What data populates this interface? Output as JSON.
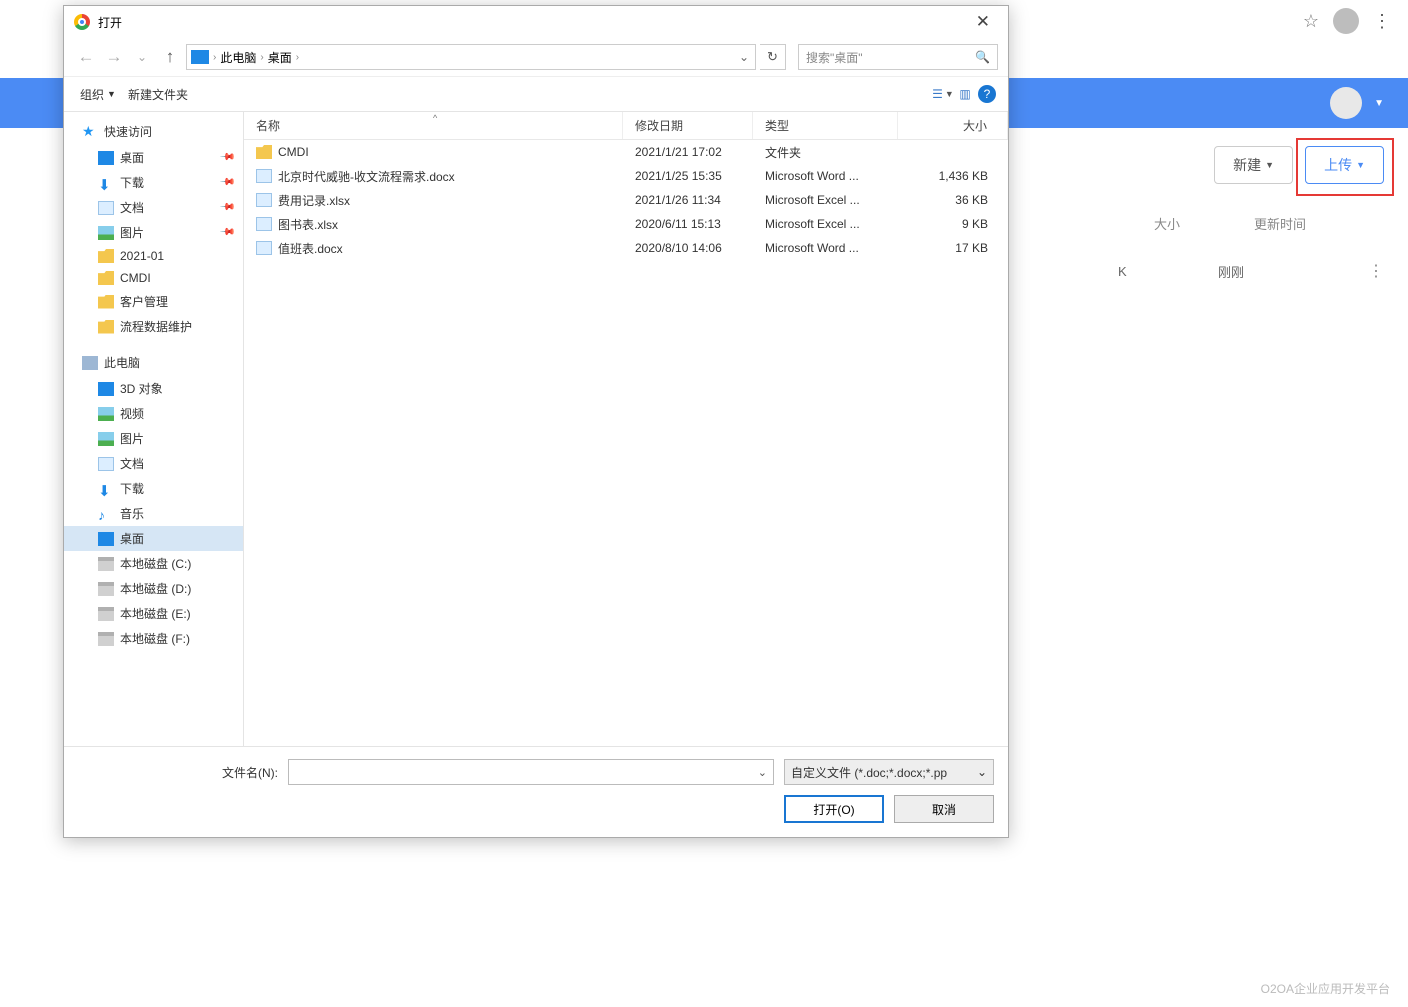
{
  "browser": {
    "star": "☆",
    "kebab": "⋮"
  },
  "web": {
    "new_label": "新建",
    "upload_label": "上传",
    "col_size": "大小",
    "col_time": "更新时间",
    "row_size": "K",
    "row_time": "刚刚",
    "row_more": "⋮"
  },
  "watermark": "O2OA企业应用开发平台",
  "dialog": {
    "title": "打开",
    "close_x": "✕",
    "path": {
      "seg1": "此电脑",
      "seg2": "桌面"
    },
    "refresh": "↻",
    "search_placeholder": "搜索\"桌面\"",
    "search_icon": "🔍",
    "toolbar": {
      "organize": "组织",
      "new_folder": "新建文件夹",
      "view_glyph": "☰",
      "panel_glyph": "▥"
    },
    "tree": {
      "quick": "快速访问",
      "quick_items": [
        {
          "label": "桌面",
          "ico": "blue-sq",
          "pin": true
        },
        {
          "label": "下载",
          "ico": "arrow-down",
          "pin": true
        },
        {
          "label": "文档",
          "ico": "doc",
          "pin": true
        },
        {
          "label": "图片",
          "ico": "pic",
          "pin": true
        },
        {
          "label": "2021-01",
          "ico": "folder"
        },
        {
          "label": "CMDI",
          "ico": "folder"
        },
        {
          "label": "客户管理",
          "ico": "folder"
        },
        {
          "label": "流程数据维护",
          "ico": "folder"
        }
      ],
      "pc": "此电脑",
      "pc_items": [
        {
          "label": "3D 对象",
          "ico": "blue-sq"
        },
        {
          "label": "视频",
          "ico": "pic"
        },
        {
          "label": "图片",
          "ico": "pic"
        },
        {
          "label": "文档",
          "ico": "doc"
        },
        {
          "label": "下载",
          "ico": "arrow-down"
        },
        {
          "label": "音乐",
          "ico": "music"
        },
        {
          "label": "桌面",
          "ico": "blue-sq",
          "selected": true
        },
        {
          "label": "本地磁盘 (C:)",
          "ico": "drive"
        },
        {
          "label": "本地磁盘 (D:)",
          "ico": "drive"
        },
        {
          "label": "本地磁盘 (E:)",
          "ico": "drive"
        },
        {
          "label": "本地磁盘 (F:)",
          "ico": "drive"
        }
      ]
    },
    "files": {
      "head": {
        "name": "名称",
        "date": "修改日期",
        "type": "类型",
        "size": "大小",
        "sort": "^"
      },
      "rows": [
        {
          "name": "CMDI",
          "date": "2021/1/21 17:02",
          "type": "文件夹",
          "size": "",
          "ico": "folder"
        },
        {
          "name": "北京时代威驰-收文流程需求.docx",
          "date": "2021/1/25 15:35",
          "type": "Microsoft Word ...",
          "size": "1,436 KB",
          "ico": "doc"
        },
        {
          "name": "费用记录.xlsx",
          "date": "2021/1/26 11:34",
          "type": "Microsoft Excel ...",
          "size": "36 KB",
          "ico": "doc"
        },
        {
          "name": "图书表.xlsx",
          "date": "2020/6/11 15:13",
          "type": "Microsoft Excel ...",
          "size": "9 KB",
          "ico": "doc"
        },
        {
          "name": "值班表.docx",
          "date": "2020/8/10 14:06",
          "type": "Microsoft Word ...",
          "size": "17 KB",
          "ico": "doc"
        }
      ]
    },
    "footer": {
      "label": "文件名(N):",
      "filter": "自定义文件 (*.doc;*.docx;*.pp",
      "open": "打开(O)",
      "cancel": "取消",
      "chev": "⌄"
    }
  }
}
